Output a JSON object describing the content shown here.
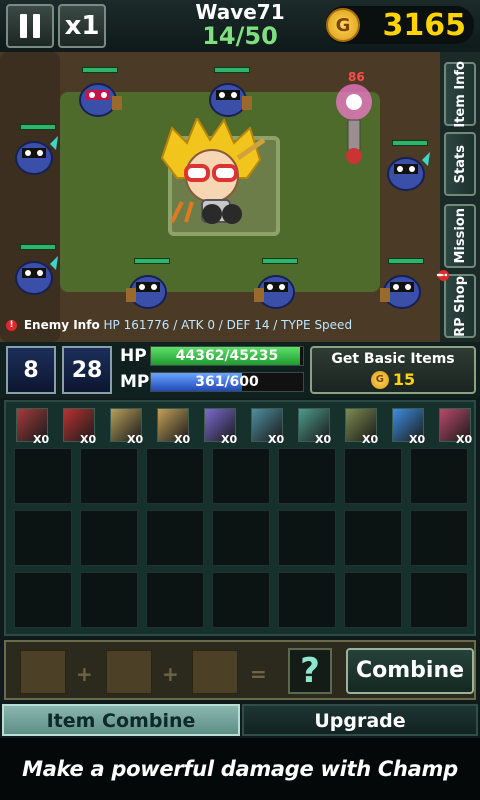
{
  "topbar": {
    "pause_icon": "pause-icon",
    "speed_label": "x1",
    "wave_title": "Wave71",
    "wave_progress": "14/50",
    "gold_symbol": "G",
    "gold_amount": "3165"
  },
  "battlefield": {
    "enemy_damage_text": "86",
    "enemy_info_label": "Enemy Info",
    "enemy_info_stats": "HP 161776 / ATK 0 / DEF 14 / TYPE Speed"
  },
  "side_tabs": [
    {
      "label": "Item Info"
    },
    {
      "label": "Stats"
    },
    {
      "label": "Mission"
    },
    {
      "label": "RP Shop",
      "alert": "!"
    }
  ],
  "stats": {
    "skill1_value": "8",
    "skill2_value": "28",
    "hp_label": "HP",
    "hp_text": "44362/45235",
    "hp_fraction": 0.98,
    "mp_label": "MP",
    "mp_text": "361/600",
    "mp_fraction": 0.6,
    "basic_items_label": "Get Basic Items",
    "basic_items_cost": "15",
    "gold_symbol": "G"
  },
  "inventory": {
    "items": [
      {
        "name": "sword",
        "count": "X0",
        "color": "#a33b3b"
      },
      {
        "name": "blade",
        "count": "X0",
        "color": "#b83232"
      },
      {
        "name": "bow",
        "count": "X0",
        "color": "#b6a05a"
      },
      {
        "name": "staff",
        "count": "X0",
        "color": "#c2a15a"
      },
      {
        "name": "wand",
        "count": "X0",
        "color": "#7b6ad0"
      },
      {
        "name": "axe",
        "count": "X0",
        "color": "#4f8fa0"
      },
      {
        "name": "shield",
        "count": "X0",
        "color": "#4d9c8a"
      },
      {
        "name": "armor",
        "count": "X0",
        "color": "#7c8b4d"
      },
      {
        "name": "orb",
        "count": "X0",
        "color": "#3d8fe0"
      },
      {
        "name": "tome",
        "count": "X0",
        "color": "#b84a6a"
      }
    ]
  },
  "combine": {
    "plus": "+",
    "equals": "=",
    "result": "?",
    "button_label": "Combine"
  },
  "tabs": {
    "item_combine": "Item Combine",
    "upgrade": "Upgrade"
  },
  "banner": {
    "text": "Make a powerful damage with Champ skill!"
  }
}
